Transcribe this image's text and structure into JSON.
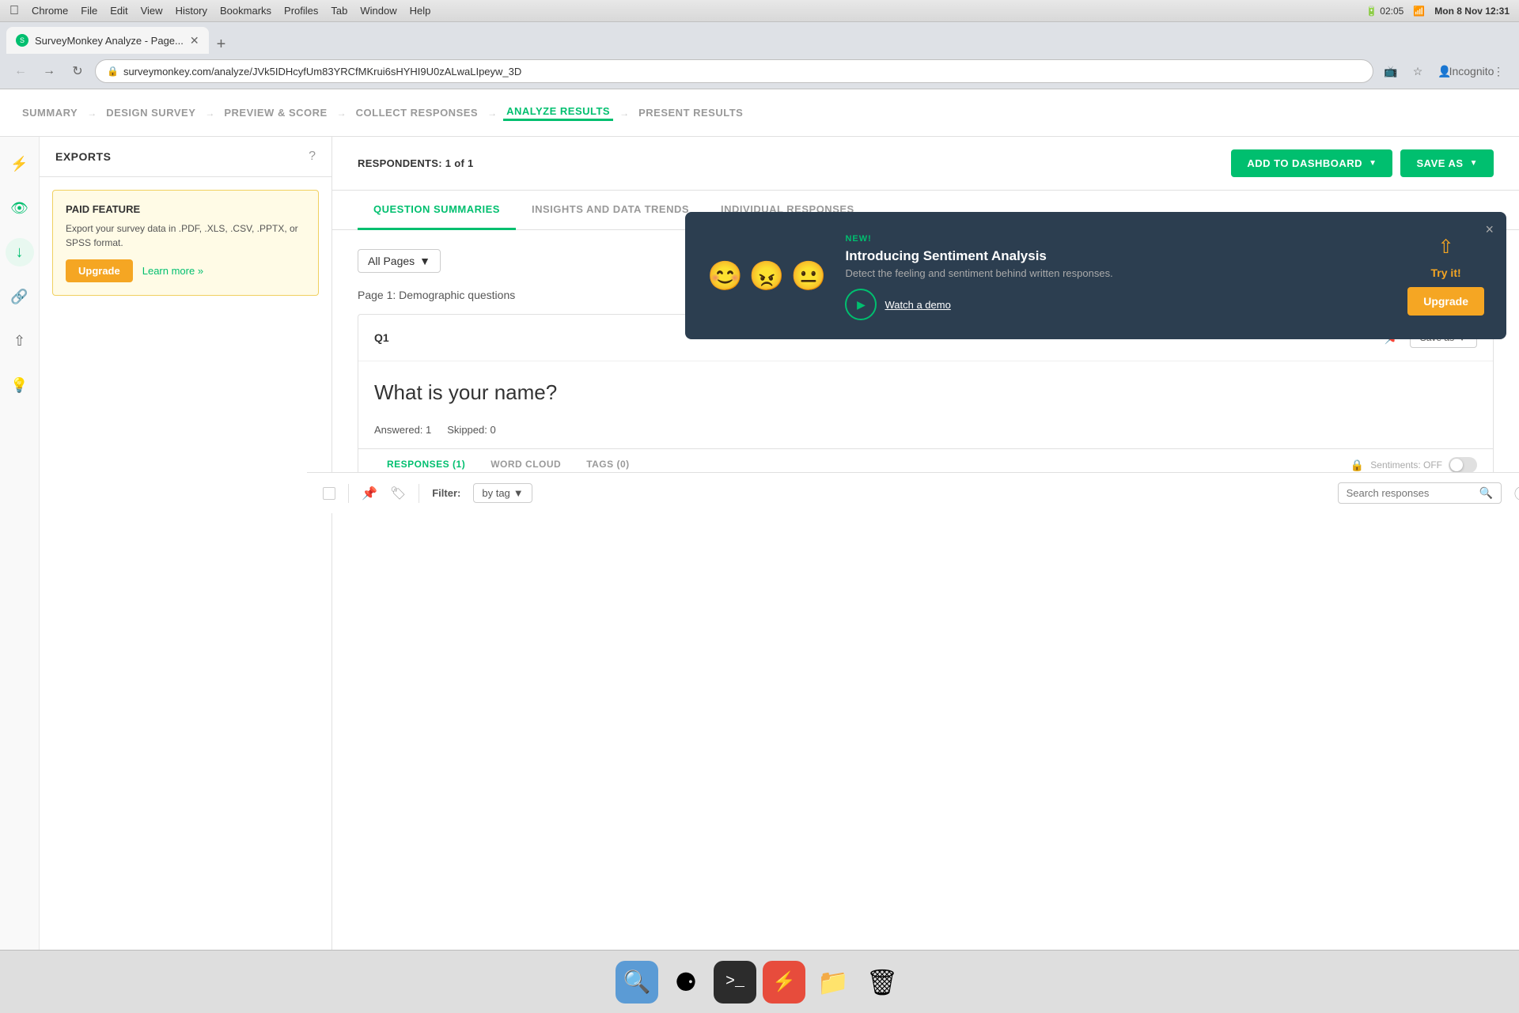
{
  "mac_bar": {
    "menus": [
      "Chrome",
      "File",
      "Edit",
      "View",
      "History",
      "Bookmarks",
      "Profiles",
      "Tab",
      "Window",
      "Help"
    ],
    "battery_icon": "🔋",
    "time": "Mon 8 Nov  12:31"
  },
  "browser": {
    "tab_title": "SurveyMonkey Analyze - Page...",
    "address": "surveymonkey.com/analyze/JVk5IDHcyfUm83YRCfMKrui6sHYHI9U0zALwaLIpeyw_3D",
    "incognito_label": "Incognito"
  },
  "top_nav": {
    "steps": [
      {
        "id": "summary",
        "label": "SUMMARY"
      },
      {
        "id": "design-survey",
        "label": "DESIGN SURVEY"
      },
      {
        "id": "preview-score",
        "label": "PREVIEW & SCORE"
      },
      {
        "id": "collect-responses",
        "label": "COLLECT RESPONSES"
      },
      {
        "id": "analyze-results",
        "label": "ANALYZE RESULTS",
        "active": true
      },
      {
        "id": "present-results",
        "label": "PRESENT RESULTS"
      }
    ]
  },
  "sidebar": {
    "title": "EXPORTS",
    "help_icon": "?",
    "paid_feature": {
      "title": "PAID FEATURE",
      "description": "Export your survey data in .PDF, .XLS, .CSV, .PPTX, or SPSS format.",
      "upgrade_label": "Upgrade",
      "learn_more_label": "Learn more »"
    }
  },
  "sidebar_icons": [
    {
      "name": "filter-icon",
      "symbol": "⚡",
      "active": false
    },
    {
      "name": "eye-icon",
      "symbol": "👁",
      "active": true
    },
    {
      "name": "download-icon",
      "symbol": "↓",
      "active": false
    },
    {
      "name": "link-icon",
      "symbol": "🔗",
      "active": false
    },
    {
      "name": "share-icon",
      "symbol": "↗",
      "active": false
    },
    {
      "name": "lightbulb-icon",
      "symbol": "💡",
      "active": false
    }
  ],
  "main_panel": {
    "respondents_text": "RESPONDENTS: 1 of 1",
    "add_dashboard_label": "ADD TO DASHBOARD",
    "save_as_label": "SAVE AS",
    "tabs": [
      {
        "id": "question-summaries",
        "label": "QUESTION SUMMARIES",
        "active": true
      },
      {
        "id": "insights-data-trends",
        "label": "INSIGHTS AND DATA TRENDS"
      },
      {
        "id": "individual-responses",
        "label": "INDIVIDUAL RESPONSES"
      }
    ],
    "pages_filter": "All Pages",
    "page_label": "Page 1: Demographic questions",
    "question": {
      "num": "Q1",
      "text": "What is your name?",
      "answered": "Answered: 1",
      "skipped": "Skipped: 0",
      "save_as_label": "Save as",
      "response_tabs": [
        {
          "id": "responses",
          "label": "RESPONSES (1)",
          "active": true
        },
        {
          "id": "word-cloud",
          "label": "WORD CLOUD"
        },
        {
          "id": "tags",
          "label": "TAGS (0)"
        }
      ],
      "sentiments_label": "Sentiments: OFF"
    }
  },
  "sentiment_popup": {
    "new_badge": "NEW!",
    "title": "Introducing Sentiment Analysis",
    "description": "Detect the feeling and sentiment behind written responses.",
    "watch_label": "Watch a demo",
    "try_label": "Try it!",
    "upgrade_label": "Upgrade",
    "close_icon": "×"
  },
  "bottom_toolbar": {
    "filter_label": "Filter:",
    "by_tag_label": "by tag",
    "search_placeholder": "Search responses"
  },
  "dock": {
    "items": [
      {
        "name": "finder-icon",
        "symbol": "🔍",
        "color": "#5b9bd5"
      },
      {
        "name": "chrome-icon",
        "symbol": "◉",
        "color": "#db4437"
      },
      {
        "name": "terminal-icon",
        "symbol": "⬛",
        "color": "#333"
      },
      {
        "name": "spark-icon",
        "symbol": "⚡",
        "color": "#f5a623"
      },
      {
        "name": "folder-icon",
        "symbol": "📁",
        "color": "#888"
      },
      {
        "name": "trash-icon",
        "symbol": "🗑",
        "color": "#888"
      }
    ]
  }
}
